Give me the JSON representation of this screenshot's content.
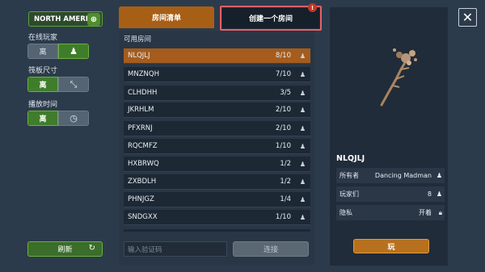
{
  "region": {
    "label": "NORTH AMERICA",
    "icon": "globe-icon"
  },
  "options": [
    {
      "label": "在线玩家",
      "off_label": "离",
      "active": "icon",
      "icon": "players-icon"
    },
    {
      "label": "筏板尺寸",
      "on_label": "离",
      "active": "text",
      "icon": "raft-icon"
    },
    {
      "label": "播放时间",
      "on_label": "离",
      "active": "text",
      "icon": "clock-icon"
    }
  ],
  "refresh": {
    "label": "刷新",
    "icon": "refresh-icon"
  },
  "tabs": {
    "list": "房间清单",
    "create": "创建一个房间",
    "badge": "!"
  },
  "list_title": "可用房间",
  "rooms": [
    {
      "code": "NLQJLJ",
      "count": "8/10"
    },
    {
      "code": "MNZNQH",
      "count": "7/10"
    },
    {
      "code": "CLHDHH",
      "count": "3/5"
    },
    {
      "code": "JKRHLM",
      "count": "2/10"
    },
    {
      "code": "PFXRNJ",
      "count": "2/10"
    },
    {
      "code": "RQCMFZ",
      "count": "1/10"
    },
    {
      "code": "HXBRWQ",
      "count": "1/2"
    },
    {
      "code": "ZXBDLH",
      "count": "1/2"
    },
    {
      "code": "PHNJGZ",
      "count": "1/4"
    },
    {
      "code": "SNDGXX",
      "count": "1/10"
    }
  ],
  "code_input": {
    "placeholder": "输入验证码"
  },
  "connect": "连接",
  "close": "✕",
  "detail": {
    "code": "NLQJLJ",
    "owner_label": "所有者",
    "owner_value": "Dancing Madman",
    "players_label": "玩家们",
    "players_value": "8",
    "privacy_label": "隐私",
    "privacy_value": "开着"
  },
  "play": "玩",
  "colors": {
    "accent_orange": "#a75f16",
    "accent_green": "#3f7d2b",
    "highlight": "#e85f66"
  }
}
